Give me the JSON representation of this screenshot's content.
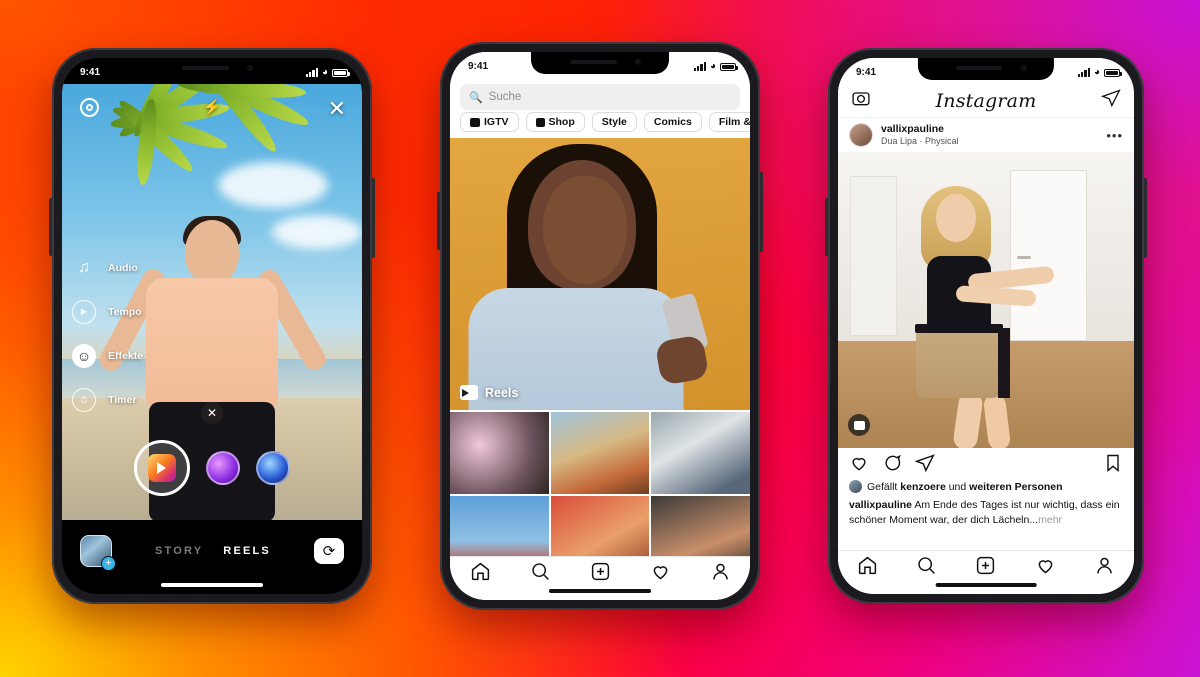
{
  "background": {
    "colors": [
      "#ff7a00",
      "#ff2200",
      "#ff0033",
      "#f0007a",
      "#c914d6",
      "#ffd400"
    ]
  },
  "phones": {
    "left": {
      "status": {
        "time": "9:41"
      },
      "topbar": {
        "settings_icon": "settings-gear-icon",
        "flash_label": "⚡",
        "close_label": "✕"
      },
      "tools": [
        {
          "icon": "music-note-icon",
          "glyph": "♫",
          "label": "Audio"
        },
        {
          "icon": "speed-tempo-icon",
          "glyph": "▶",
          "label": "Tempo"
        },
        {
          "icon": "smiley-effects-icon",
          "glyph": "☺",
          "label": "Effekte"
        },
        {
          "icon": "timer-clock-icon",
          "glyph": "⏱",
          "label": "Timer"
        }
      ],
      "clear_label": "✕",
      "shutter": {
        "name": "reels-shutter-button"
      },
      "effects": [
        {
          "name": "effect-purple"
        },
        {
          "name": "effect-blue"
        }
      ],
      "bottom": {
        "gallery_plus": "+",
        "modes": [
          {
            "label": "STORY",
            "active": false
          },
          {
            "label": "REELS",
            "active": true
          }
        ],
        "flip_glyph": "⟳"
      }
    },
    "middle": {
      "status": {
        "time": "9:41"
      },
      "search": {
        "placeholder": "Suche",
        "icon": "search-icon"
      },
      "chips": [
        {
          "label": "IGTV",
          "icon": "igtv-icon"
        },
        {
          "label": "Shop",
          "icon": "shop-bag-icon"
        },
        {
          "label": "Style",
          "icon": ""
        },
        {
          "label": "Comics",
          "icon": ""
        },
        {
          "label": "Film & Fern",
          "icon": ""
        }
      ],
      "hero": {
        "tag_label": "Reels",
        "tag_icon": "clapper-board-icon"
      },
      "thumbnails": [
        {
          "name": "thumb-blossoms"
        },
        {
          "name": "thumb-couple-swing"
        },
        {
          "name": "thumb-skateboard"
        },
        {
          "name": "thumb-landmark-sky"
        },
        {
          "name": "thumb-red-coat"
        },
        {
          "name": "thumb-child-car"
        }
      ],
      "tabbar": [
        {
          "name": "home",
          "icon": "home-icon"
        },
        {
          "name": "search",
          "icon": "search-icon"
        },
        {
          "name": "create",
          "icon": "plus-square-icon"
        },
        {
          "name": "activity",
          "icon": "heart-icon"
        },
        {
          "name": "profile",
          "icon": "person-icon"
        }
      ]
    },
    "right": {
      "status": {
        "time": "9:41"
      },
      "header": {
        "camera_icon": "camera-icon",
        "title": "Instagram",
        "send_icon": "paper-plane-icon"
      },
      "post": {
        "username": "vallixpauline",
        "music": "Dua Lipa · Physical",
        "more_label": "•••",
        "reels_badge": "reels-badge-icon",
        "likes_text": "Gefällt kenzoere und weiteren Personen",
        "likes_bold_1": "kenzoere",
        "likes_bold_2": "weiteren Personen",
        "caption_user": "vallixpauline",
        "caption_text": " Am Ende des Tages ist nur wichtig, dass ein schöner Moment war, der dich Lächeln...",
        "caption_more": "mehr"
      },
      "tabbar": [
        {
          "name": "home",
          "icon": "home-icon"
        },
        {
          "name": "search",
          "icon": "search-icon"
        },
        {
          "name": "create",
          "icon": "plus-square-icon"
        },
        {
          "name": "activity",
          "icon": "heart-icon"
        },
        {
          "name": "profile",
          "icon": "person-icon"
        }
      ]
    }
  }
}
